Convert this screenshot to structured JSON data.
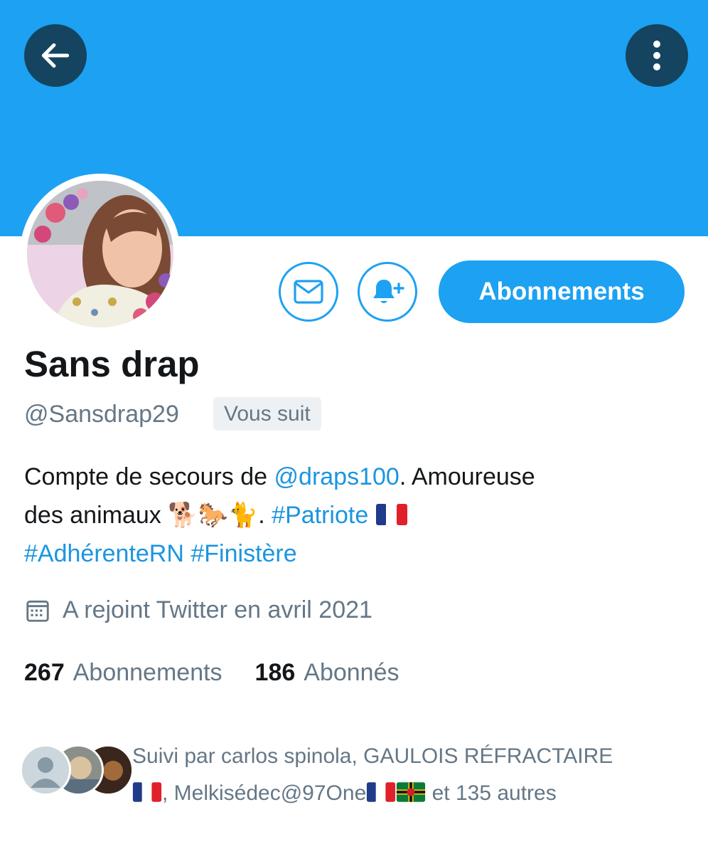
{
  "profile": {
    "name": "Sans drap",
    "handle": "@Sansdrap29",
    "follows_you": "Vous suit",
    "follow_button": "Abonnements",
    "bio_line1_prefix": "Compte de secours de ",
    "bio_mention": "@draps100",
    "bio_line1_suffix": ". Amoureuse",
    "bio_line2_prefix": "des animaux ",
    "bio_emojis": "🐕🐎🐈",
    "bio_line2_dot": ". ",
    "hashtag_patriote": "#Patriote",
    "hashtag_adherente": "#AdhérenteRN",
    "hashtag_finistere": "#Finistère",
    "joined": "A rejoint Twitter en avril 2021",
    "following_count": "267",
    "following_label": "Abonnements",
    "followers_count": "186",
    "followers_label": "Abonnés",
    "followed_by_part1": "Suivi par carlos spinola, GAULOIS RÉFRACTAIRE",
    "followed_by_part2": ", Melkisédec@97One",
    "followed_by_part3": " et 135 autres"
  },
  "colors": {
    "banner": "#1da1f2",
    "accent": "#1da1f2",
    "link": "#1b95e0",
    "secondary_text": "#657786",
    "round_button": "#14445f"
  },
  "icons": {
    "back": "arrow-left-icon",
    "more": "more-vertical-icon",
    "message": "envelope-icon",
    "notify": "bell-plus-icon",
    "joined": "calendar-icon",
    "flag": "france-flag-icon",
    "dominica_flag": "dominica-flag-icon"
  }
}
